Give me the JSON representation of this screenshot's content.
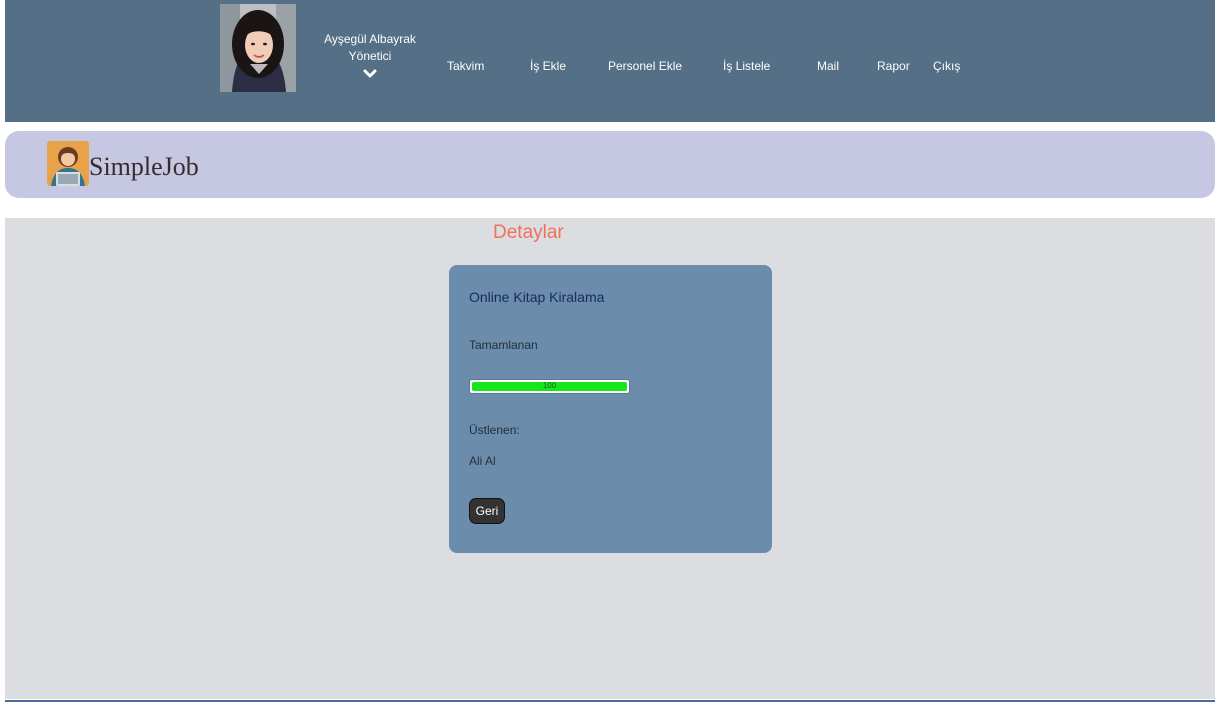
{
  "user": {
    "name": "Ayşegül Albayrak",
    "role": "Yönetici"
  },
  "nav": {
    "items": [
      {
        "label": "Takvim"
      },
      {
        "label": "İş Ekle"
      },
      {
        "label": "Personel Ekle"
      },
      {
        "label": "İş Listele"
      },
      {
        "label": "Mail"
      },
      {
        "label": "Rapor"
      },
      {
        "label": "Çıkış"
      }
    ]
  },
  "brand": {
    "name": "SimpleJob"
  },
  "page": {
    "title": "Detaylar"
  },
  "job": {
    "title": "Online Kitap Kiralama",
    "completed_label": "Tamamlanan",
    "progress_value": 100,
    "progress_text": "100",
    "assignee_label": "Üstlenen:",
    "assignee_name": "Ali Al",
    "back_label": "Geri"
  },
  "colors": {
    "topbar": "#546f86",
    "brandbar": "#c5c7e3",
    "page_bg": "#dcdde1",
    "card": "#6c8cab",
    "title_accent": "#f26f5c",
    "progress_fill": "#16e61a"
  }
}
